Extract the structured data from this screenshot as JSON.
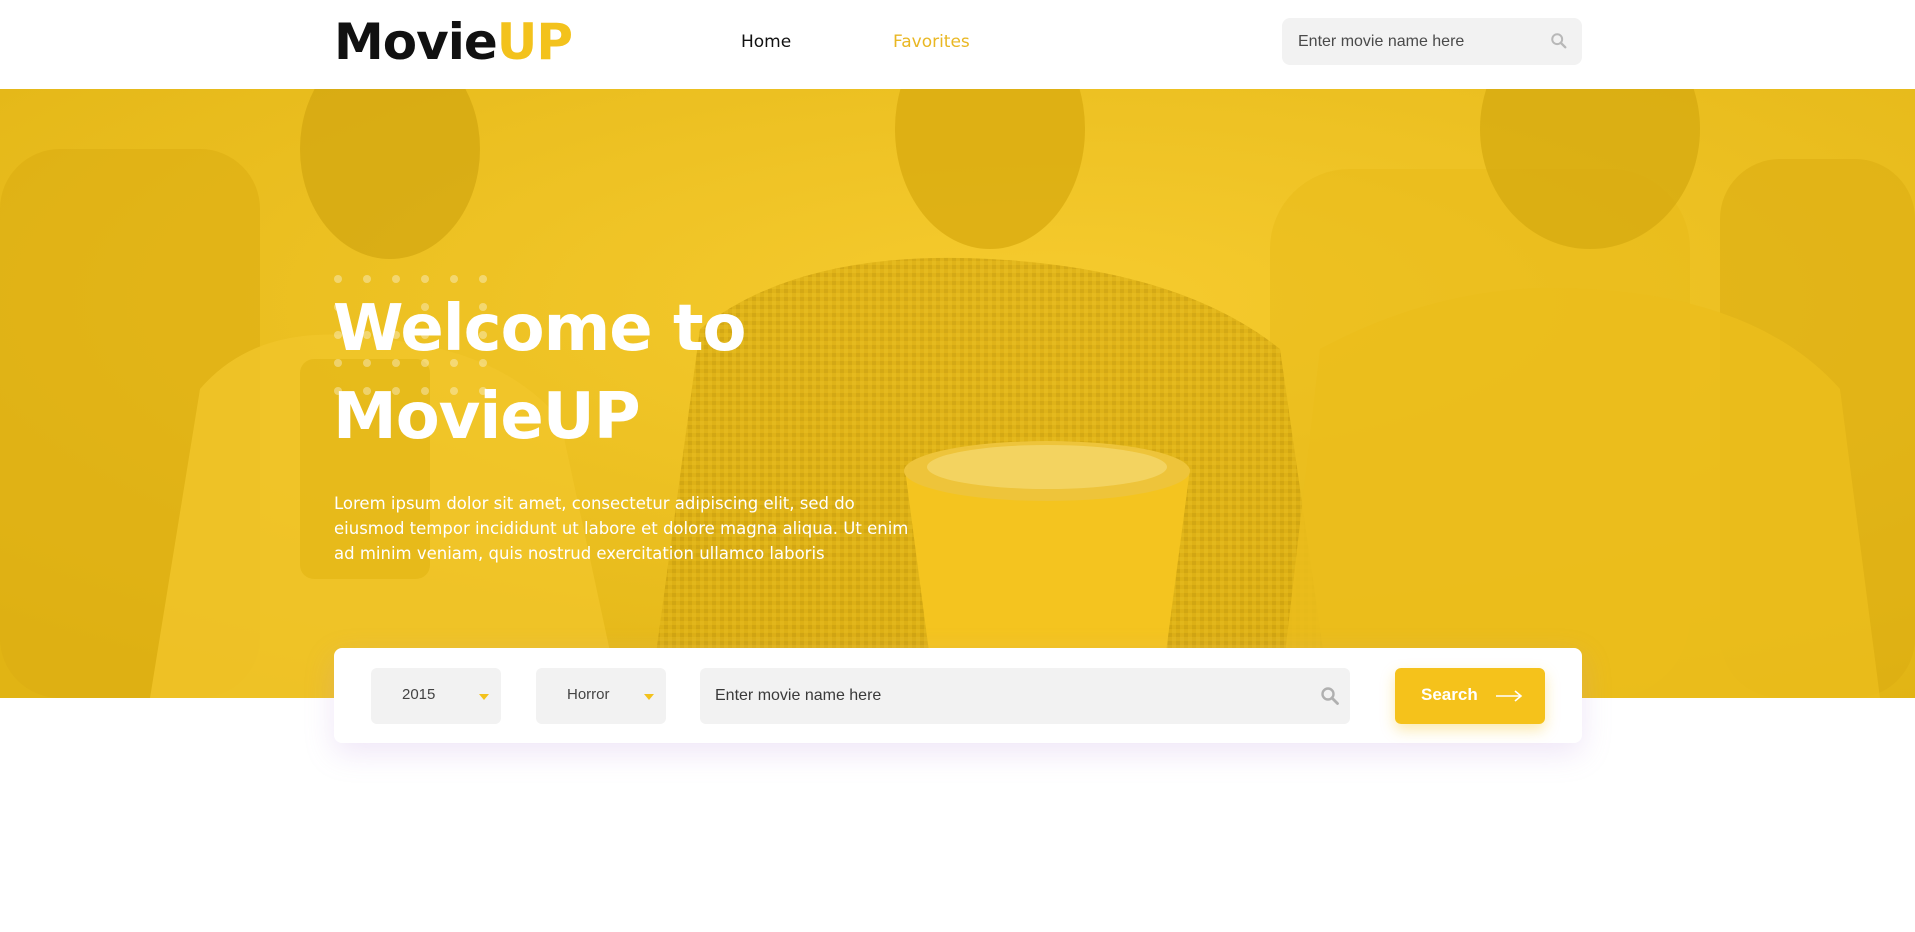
{
  "header": {
    "logo_dark": "Movie",
    "logo_accent": "UP",
    "nav": {
      "home": "Home",
      "favorites": "Favorites"
    },
    "search": {
      "placeholder": "Enter movie name here",
      "icon": "search-icon"
    }
  },
  "hero": {
    "title_line1": "Welcome to",
    "title_line2": "MovieUP",
    "text": "Lorem ipsum dolor sit amet, consectetur adipiscing elit, sed do eiusmod tempor incididunt ut labore et dolore magna aliqua. Ut enim ad minim veniam, quis nostrud exercitation ullamco laboris"
  },
  "search_panel": {
    "year_selected": "2015",
    "genre_selected": "Horror",
    "placeholder": "Enter movie name here",
    "button_label": "Search",
    "button_icon": "arrow-right-icon",
    "search_icon": "search-icon"
  },
  "colors": {
    "accent": "#f3c21c",
    "hero_overlay": "#e6b916",
    "text_dark": "#111111",
    "field_bg": "#f2f2f2"
  }
}
